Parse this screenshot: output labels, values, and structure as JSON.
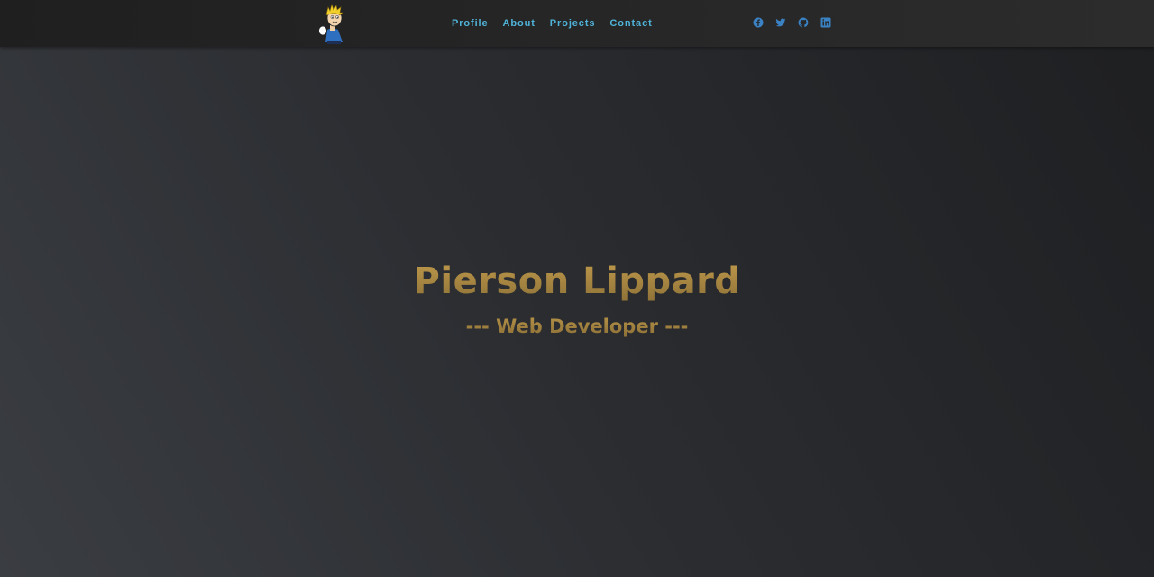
{
  "nav": {
    "logo_icon": "cartoon-avatar-icon",
    "links": [
      {
        "label": "Profile"
      },
      {
        "label": "About"
      },
      {
        "label": "Projects"
      },
      {
        "label": "Contact"
      }
    ],
    "socials": [
      {
        "icon": "facebook-icon"
      },
      {
        "icon": "twitter-icon"
      },
      {
        "icon": "github-icon"
      },
      {
        "icon": "linkedin-icon"
      }
    ]
  },
  "hero": {
    "name": "Pierson Lippard",
    "role": "--- Web Developer ---"
  },
  "colors": {
    "background_light": "#3a3d42",
    "background_dark": "#1e1f21",
    "navbar": "#262626",
    "nav_link": "#4fb3d8",
    "social_icon": "#3b82c4",
    "hero_gold": "#a88a46"
  }
}
